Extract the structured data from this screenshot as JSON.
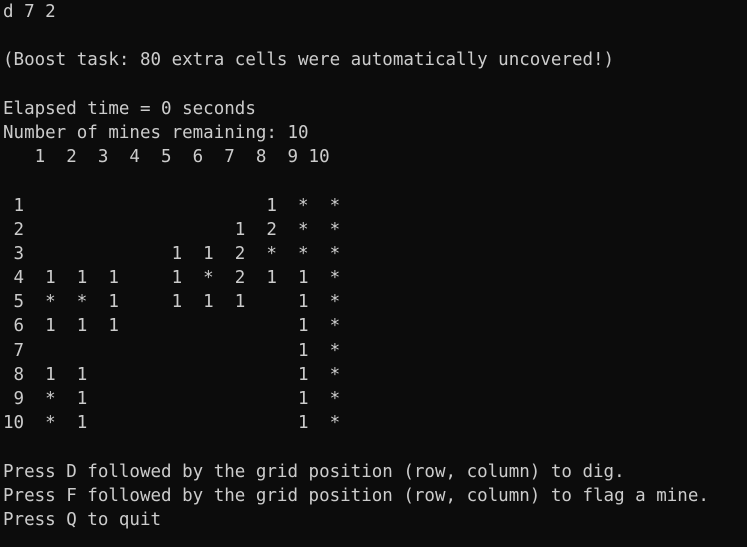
{
  "console": {
    "input_command": "d 7 2",
    "boost_message": "(Boost task: 80 extra cells were automatically uncovered!)",
    "elapsed_time": "Elapsed time = 0 seconds",
    "mines_remaining": "Number of mines remaining: 10",
    "grid_header": "   1  2  3  4  5  6  7  8  9 10",
    "grid_rows": [
      " 1                       1  *  *",
      " 2                    1  2  *  *",
      " 3              1  1  2  *  *  *",
      " 4  1  1  1     1  *  2  1  1  *",
      " 5  *  *  1     1  1  1     1  *",
      " 6  1  1  1                 1  *",
      " 7                          1  *",
      " 8  1  1                    1  *",
      " 9  *  1                    1  *",
      "10  *  1                    1  *"
    ],
    "instructions": [
      "Press D followed by the grid position (row, column) to dig.",
      "Press F followed by the grid position (row, column) to flag a mine.",
      "Press Q to quit"
    ]
  },
  "colors": {
    "background": "#0c0c0c",
    "text": "#cccccc"
  }
}
